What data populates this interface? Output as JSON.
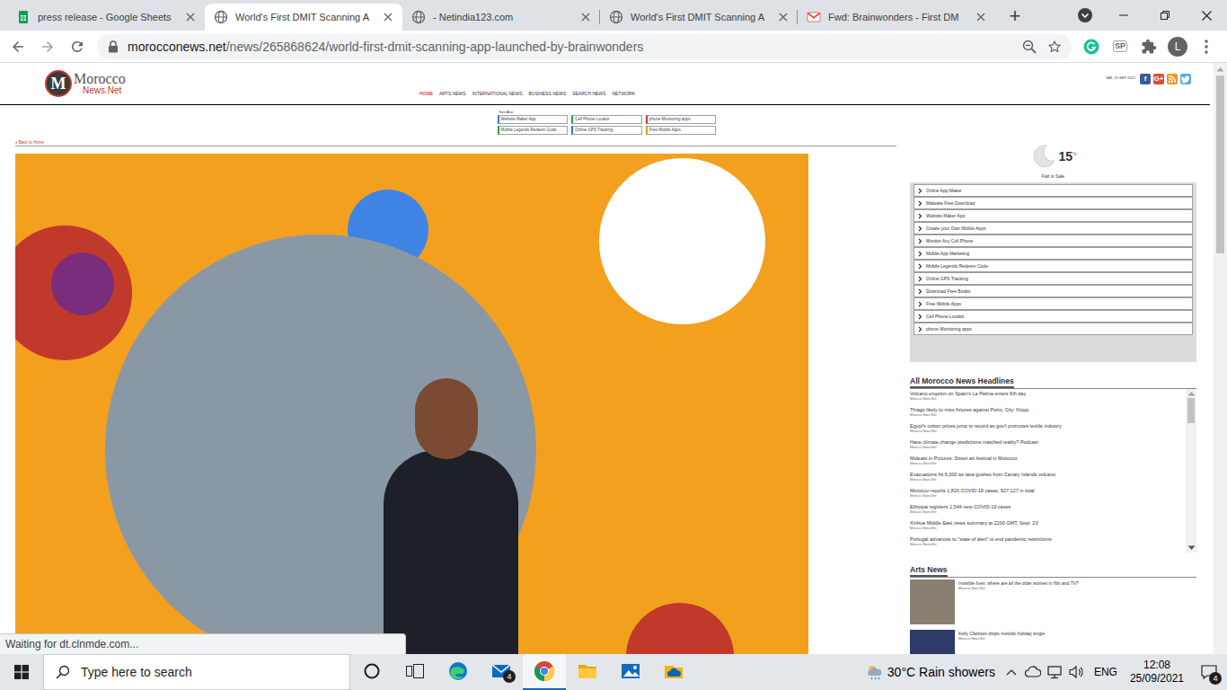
{
  "browser": {
    "tabs": [
      {
        "label": "press release - Google Sheets",
        "selected": false,
        "kind": "sheets"
      },
      {
        "label": "World's First DMIT Scanning A",
        "selected": true,
        "kind": "globe"
      },
      {
        "label": "- Netindia123.com",
        "selected": false,
        "kind": "globe"
      },
      {
        "label": "World's First DMIT Scanning A",
        "selected": false,
        "kind": "globe"
      },
      {
        "label": "Fwd: Brainwonders - First DM",
        "selected": false,
        "kind": "gmail"
      }
    ],
    "new_tab": "+",
    "url_host": "morocconews.net",
    "url_path": "/news/265868624/world-first-dmit-scanning-app-launched-by-brainwonders",
    "extension": "SP",
    "profile": "L",
    "status": "Waiting for dt.clnmde.com..."
  },
  "page": {
    "logo": {
      "mark": "M",
      "line1": "Morocco",
      "line2": "News.Net"
    },
    "nav": [
      {
        "label": "HOME",
        "selected": true
      },
      {
        "label": "ARTS NEWS",
        "selected": false
      },
      {
        "label": "INTERNATIONAL NEWS",
        "selected": false
      },
      {
        "label": "BUSINESS NEWS",
        "selected": false
      },
      {
        "label": "SEARCH NEWS",
        "selected": false
      },
      {
        "label": "NETWORK",
        "selected": false
      }
    ],
    "date": "SAT, 25 SEP 2021",
    "social": [
      {
        "kind": "text",
        "glyph": "f",
        "color": "#3b5998"
      },
      {
        "kind": "text",
        "glyph": "G+",
        "color": "#dd4b39"
      },
      {
        "kind": "rss",
        "color": "#f79420"
      },
      {
        "kind": "twitter",
        "color": "#55acee"
      }
    ],
    "see_also": {
      "title": "See Also:",
      "links": [
        {
          "label": "Website Maker App",
          "color": "#3b73d9"
        },
        {
          "label": "Cell Phone Locator",
          "color": "#2e9e4f"
        },
        {
          "label": "phone Monitoring apps",
          "color": "#d93025"
        },
        {
          "label": "Mobile Legends Redeem Code",
          "color": "#2e9e4f"
        },
        {
          "label": "Online GPS Tracking",
          "color": "#3b73d9"
        },
        {
          "label": "Free Mobile Apps",
          "color": "#f29900"
        }
      ]
    },
    "back": "« Back to Home",
    "weather": {
      "temp": "15",
      "unit": "°c",
      "place": "Fair in Sale"
    },
    "ads": [
      "Online App Maker",
      "Malware Free Download",
      "Website Maker App",
      "Create your Own Mobile Apps",
      "Monitor Any Cell Phone",
      "Mobile App Marketing",
      "Mobile Legends Redeem Code",
      "Online GPS Tracking",
      "Download Free Books",
      "Free Mobile Apps",
      "Cell Phone Locator",
      "phone Monitoring apps"
    ],
    "headlines": {
      "title": "All Morocco News Headlines",
      "items": [
        {
          "title": "Volcano eruption on Spain's La Palma enters 6th day",
          "source": "Morocco News.Net"
        },
        {
          "title": "Thiago likely to miss fixtures against Porto, City: Klopp",
          "source": "Morocco News.Net"
        },
        {
          "title": "Egypt's cotton prices jump to record as gov't promotes textile industry",
          "source": "Morocco News.Net"
        },
        {
          "title": "Have climate change predictions matched reality? Podcast",
          "source": "Morocco News.Net"
        },
        {
          "title": "Mideast in Pictures: Street art festival in Morocco",
          "source": "Morocco News.Net"
        },
        {
          "title": "Evacuations hit 6,000 as lava gushes from Canary Islands volcano",
          "source": "Morocco News.Net"
        },
        {
          "title": "Morocco reports 1,820 COVID-19 cases, 927,127 in total",
          "source": "Morocco News.Net"
        },
        {
          "title": "Ethiopia registers 1,544 new COVID-19 cases",
          "source": "Morocco News.Net"
        },
        {
          "title": "Xinhua Middle East news summary at 2200 GMT, Sept. 23",
          "source": "Morocco News.Net"
        },
        {
          "title": "Portugal advances to \"state of alert\" to end pandemic restrictions",
          "source": "Morocco News.Net"
        }
      ]
    },
    "arts": {
      "title": "Arts News",
      "items": [
        {
          "title": "Invisible lives: where are all the older women in film and TV?",
          "source": "Morocco News.Net"
        },
        {
          "title": "Kelly Clarkson drops melodic holiday single",
          "source": "Morocco News.Net"
        }
      ]
    }
  },
  "taskbar": {
    "search_placeholder": "Type here to search",
    "apps": [
      {
        "kind": "cortana",
        "selected": false
      },
      {
        "kind": "taskview",
        "selected": false
      },
      {
        "kind": "edge",
        "selected": false
      },
      {
        "kind": "mail",
        "selected": false,
        "badge": "4"
      },
      {
        "kind": "chrome",
        "selected": true
      },
      {
        "kind": "explorer",
        "selected": false
      },
      {
        "kind": "photos",
        "selected": false
      },
      {
        "kind": "onedrive",
        "selected": false
      }
    ],
    "weather_temp": "30°C",
    "weather_text": "Rain showers",
    "language": "ENG",
    "time": "12:08",
    "date": "25/09/2021",
    "notifications": "4"
  }
}
